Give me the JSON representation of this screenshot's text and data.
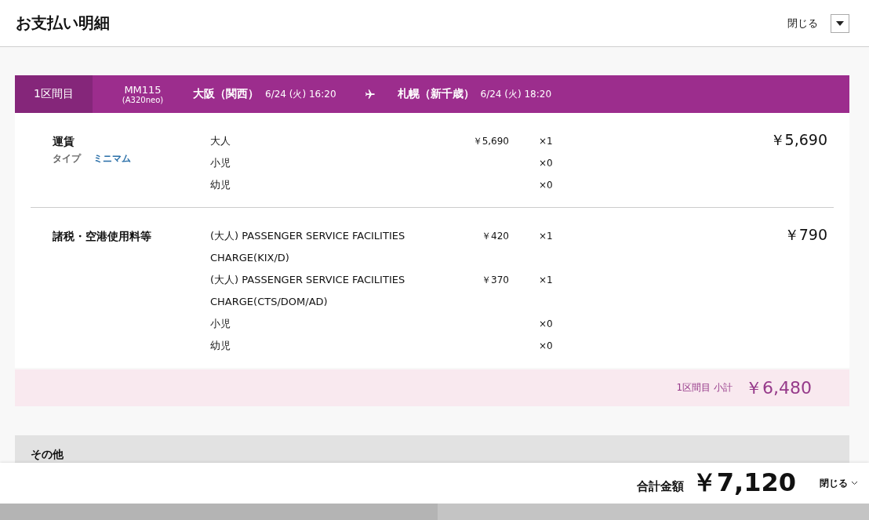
{
  "header": {
    "title": "お支払い明細",
    "close_label": "閉じる"
  },
  "segment": {
    "label": "1区間目",
    "flight": "MM115",
    "aircraft": "(A320neo)",
    "from": "大阪（関西）",
    "from_time": "6/24 (火) 16:20",
    "to": "札幌（新千歳）",
    "to_time": "6/24 (火) 18:20"
  },
  "sections": [
    {
      "title": "運賃",
      "type_label": "タイプ",
      "type_value": "ミニマム",
      "total": "￥5,690",
      "lines": [
        {
          "name": "大人",
          "unit": "￥5,690",
          "qty": "×1"
        },
        {
          "name": "小児",
          "qty": "×0"
        },
        {
          "name": "幼児",
          "qty": "×0"
        }
      ]
    },
    {
      "title": "諸税・空港使用料等",
      "total": "￥790",
      "lines": [
        {
          "name": "(大人) PASSENGER SERVICE FACILITIES CHARGE(KIX/D)",
          "unit": "￥420",
          "qty": "×1"
        },
        {
          "name": "(大人) PASSENGER SERVICE FACILITIES CHARGE(CTS/DOM/AD)",
          "unit": "￥370",
          "qty": "×1"
        },
        {
          "name": "小児",
          "qty": "×0"
        },
        {
          "name": "幼児",
          "qty": "×0"
        }
      ]
    }
  ],
  "subtotal": {
    "label": "1区間目 小計",
    "amount": "￥6,480"
  },
  "other": {
    "title": "その他"
  },
  "footer": {
    "total_label": "合計金額",
    "total": "￥7,120",
    "close_label": "閉じる"
  }
}
